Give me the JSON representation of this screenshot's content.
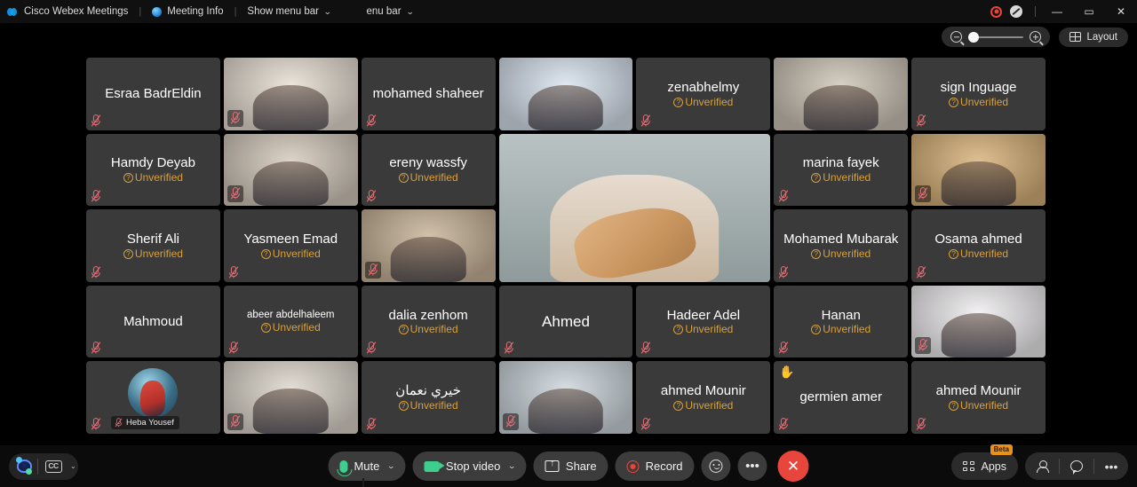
{
  "titlebar": {
    "app_name": "Cisco Webex Meetings",
    "meeting_info": "Meeting Info",
    "show_menu_bar": "Show menu bar",
    "menu_bar": "enu bar",
    "icons": {
      "webex_logo": "webex-logo",
      "info": "info-icon",
      "recording_indicator": "recording-indicator-icon",
      "muted_indicator": "muted-indicator-icon",
      "minimize": "minimize-icon",
      "maximize": "maximize-icon",
      "close": "close-icon"
    },
    "minimize": "—",
    "maximize": "▭",
    "close": "✕"
  },
  "top_controls": {
    "zoom_out_icon": "zoom-out-icon",
    "zoom_in_icon": "zoom-in-icon",
    "zoom_value": 0,
    "layout_label": "Layout",
    "layout_icon": "grid-layout-icon"
  },
  "colors": {
    "unverified": "#d9a03a",
    "accent_green": "#3ecf8e",
    "end_call_red": "#e8463c",
    "beta_badge": "#e8921e",
    "tile_background": "#3a3a3a"
  },
  "stage": {
    "unverified_label": "Unverified",
    "mic_muted_icon": "microphone-muted-icon",
    "raised_hand_icon": "raised-hand-icon",
    "columns": 7,
    "rows": 5,
    "tiles": [
      {
        "name": "Esraa BadrEldin",
        "unverified": false,
        "video": false,
        "muted": true,
        "row": 1,
        "col": 1
      },
      {
        "name": "",
        "unverified": false,
        "video": true,
        "muted": true,
        "row": 1,
        "col": 2,
        "video_tone": "#e8dfd4"
      },
      {
        "name": "mohamed shaheer",
        "unverified": false,
        "video": false,
        "muted": true,
        "row": 1,
        "col": 3
      },
      {
        "name": "",
        "unverified": false,
        "video": true,
        "muted": false,
        "row": 1,
        "col": 4,
        "video_tone": "#d9e3ef"
      },
      {
        "name": "zenabhelmy",
        "unverified": true,
        "video": false,
        "muted": true,
        "row": 1,
        "col": 5
      },
      {
        "name": "",
        "unverified": false,
        "video": true,
        "muted": false,
        "row": 1,
        "col": 6,
        "video_tone": "#cfc6b8"
      },
      {
        "name": "sign Inguage",
        "unverified": true,
        "video": false,
        "muted": true,
        "row": 1,
        "col": 7
      },
      {
        "name": "Hamdy Deyab",
        "unverified": true,
        "video": false,
        "muted": true,
        "row": 2,
        "col": 1
      },
      {
        "name": "",
        "unverified": false,
        "video": true,
        "muted": true,
        "row": 2,
        "col": 2,
        "video_tone": "#d5cbbd"
      },
      {
        "name": "ereny wassfy",
        "unverified": true,
        "video": false,
        "muted": true,
        "row": 2,
        "col": 3
      },
      {
        "name": "marina fayek",
        "unverified": true,
        "video": false,
        "muted": true,
        "row": 2,
        "col": 6
      },
      {
        "name": "",
        "unverified": false,
        "video": true,
        "muted": true,
        "row": 2,
        "col": 7,
        "video_tone": "#d8b27a"
      },
      {
        "name": "Sherif Ali",
        "unverified": true,
        "video": false,
        "muted": true,
        "row": 3,
        "col": 1
      },
      {
        "name": "Yasmeen Emad",
        "unverified": true,
        "video": false,
        "muted": true,
        "row": 3,
        "col": 2
      },
      {
        "name": "",
        "unverified": false,
        "video": true,
        "muted": true,
        "row": 3,
        "col": 3,
        "video_tone": "#c9b59a"
      },
      {
        "name": "Mohamed Mubarak",
        "unverified": true,
        "video": false,
        "muted": true,
        "row": 3,
        "col": 6
      },
      {
        "name": "Osama ahmed",
        "unverified": true,
        "video": false,
        "muted": true,
        "row": 3,
        "col": 7
      },
      {
        "name": "Mahmoud",
        "unverified": false,
        "video": false,
        "muted": true,
        "row": 4,
        "col": 1
      },
      {
        "name": "abeer abdelhaleem",
        "unverified": true,
        "video": false,
        "muted": true,
        "row": 4,
        "col": 2,
        "small_name": true
      },
      {
        "name": "dalia zenhom",
        "unverified": true,
        "video": false,
        "muted": true,
        "row": 4,
        "col": 3
      },
      {
        "name": "Ahmed",
        "unverified": false,
        "video": false,
        "muted": true,
        "row": 4,
        "col": 4,
        "big_name": true
      },
      {
        "name": "Hadeer Adel",
        "unverified": true,
        "video": false,
        "muted": true,
        "row": 4,
        "col": 5
      },
      {
        "name": "Hanan",
        "unverified": true,
        "video": false,
        "muted": true,
        "row": 4,
        "col": 6
      },
      {
        "name": "",
        "unverified": false,
        "video": true,
        "muted": true,
        "row": 4,
        "col": 7,
        "video_tone": "#f0eef0"
      },
      {
        "name": "Heba Yousef",
        "unverified": false,
        "video": false,
        "muted": true,
        "row": 5,
        "col": 1,
        "avatar": true
      },
      {
        "name": "",
        "unverified": false,
        "video": true,
        "muted": true,
        "row": 5,
        "col": 2,
        "video_tone": "#ddd6cc"
      },
      {
        "name": "خيري نعمان",
        "unverified": true,
        "video": false,
        "muted": true,
        "row": 5,
        "col": 3
      },
      {
        "name": "",
        "unverified": false,
        "video": true,
        "muted": true,
        "row": 5,
        "col": 4,
        "video_tone": "#cdd6dc"
      },
      {
        "name": "ahmed Mounir",
        "unverified": true,
        "video": false,
        "muted": true,
        "row": 5,
        "col": 5
      },
      {
        "name": "germien amer",
        "unverified": false,
        "video": false,
        "muted": true,
        "row": 5,
        "col": 6,
        "hand_raised": true
      },
      {
        "name": "ahmed Mounir",
        "unverified": true,
        "video": false,
        "muted": true,
        "row": 5,
        "col": 7
      }
    ],
    "active_speaker": {
      "name": "",
      "muted": false,
      "row_start": 2,
      "row_end": 3,
      "col_start": 4,
      "col_end": 5
    }
  },
  "toolbar": {
    "assistant_icon": "webex-assistant-icon",
    "captions_icon": "closed-captions-icon",
    "captions_label": "CC",
    "mute_label": "Mute",
    "mute_icon": "microphone-icon",
    "stop_video_label": "Stop video",
    "stop_video_icon": "camera-icon",
    "share_label": "Share",
    "share_icon": "share-screen-icon",
    "record_label": "Record",
    "record_icon": "record-icon",
    "reactions_icon": "reactions-icon",
    "more_icon": "more-options-icon",
    "more_label": "•••",
    "end_meeting_icon": "end-meeting-icon",
    "end_meeting_label": "✕",
    "apps_label": "Apps",
    "apps_icon": "apps-grid-icon",
    "beta_badge": "Beta",
    "participants_icon": "participants-icon",
    "chat_icon": "chat-icon",
    "right_more_icon": "more-options-icon",
    "chevron": "⌄"
  }
}
